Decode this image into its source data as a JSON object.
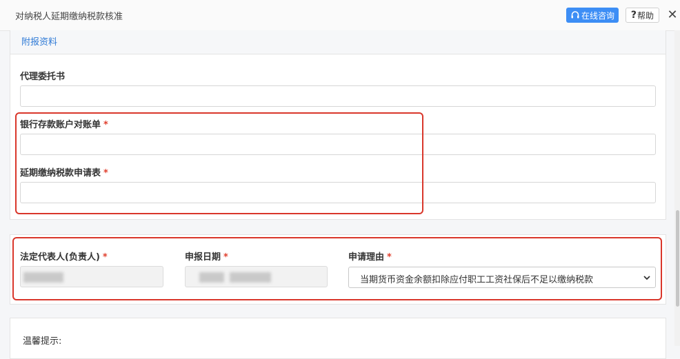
{
  "window": {
    "title": "对纳税人延期缴纳税款核准",
    "consult_label": "在线咨询",
    "help_label": "帮助",
    "help_mark": "?",
    "close_glyph": "✕"
  },
  "attachments": {
    "section_title": "附报资料",
    "fields": [
      {
        "label": "代理委托书",
        "required": false
      },
      {
        "label": "银行存款账户对账单",
        "required": true
      },
      {
        "label": "延期缴纳税款申请表",
        "required": true
      }
    ]
  },
  "form": {
    "legal_rep": {
      "label": "法定代表人(负责人)",
      "required": true
    },
    "report_date": {
      "label": "申报日期",
      "required": true
    },
    "reason": {
      "label": "申请理由",
      "required": true,
      "selected": "当期货币资金余额扣除应付职工工资社保后不足以缴纳税款"
    },
    "required_mark": "*"
  },
  "notice": {
    "tip_label": "温馨提示:"
  },
  "colors": {
    "accent": "#3d8ef5",
    "link": "#2f7ad6",
    "required": "#e0402e",
    "highlight": "#d9362a"
  },
  "icons": {
    "consult": "headset-icon",
    "help": "question-icon",
    "close": "close-icon",
    "select": "chevron-down-icon"
  }
}
